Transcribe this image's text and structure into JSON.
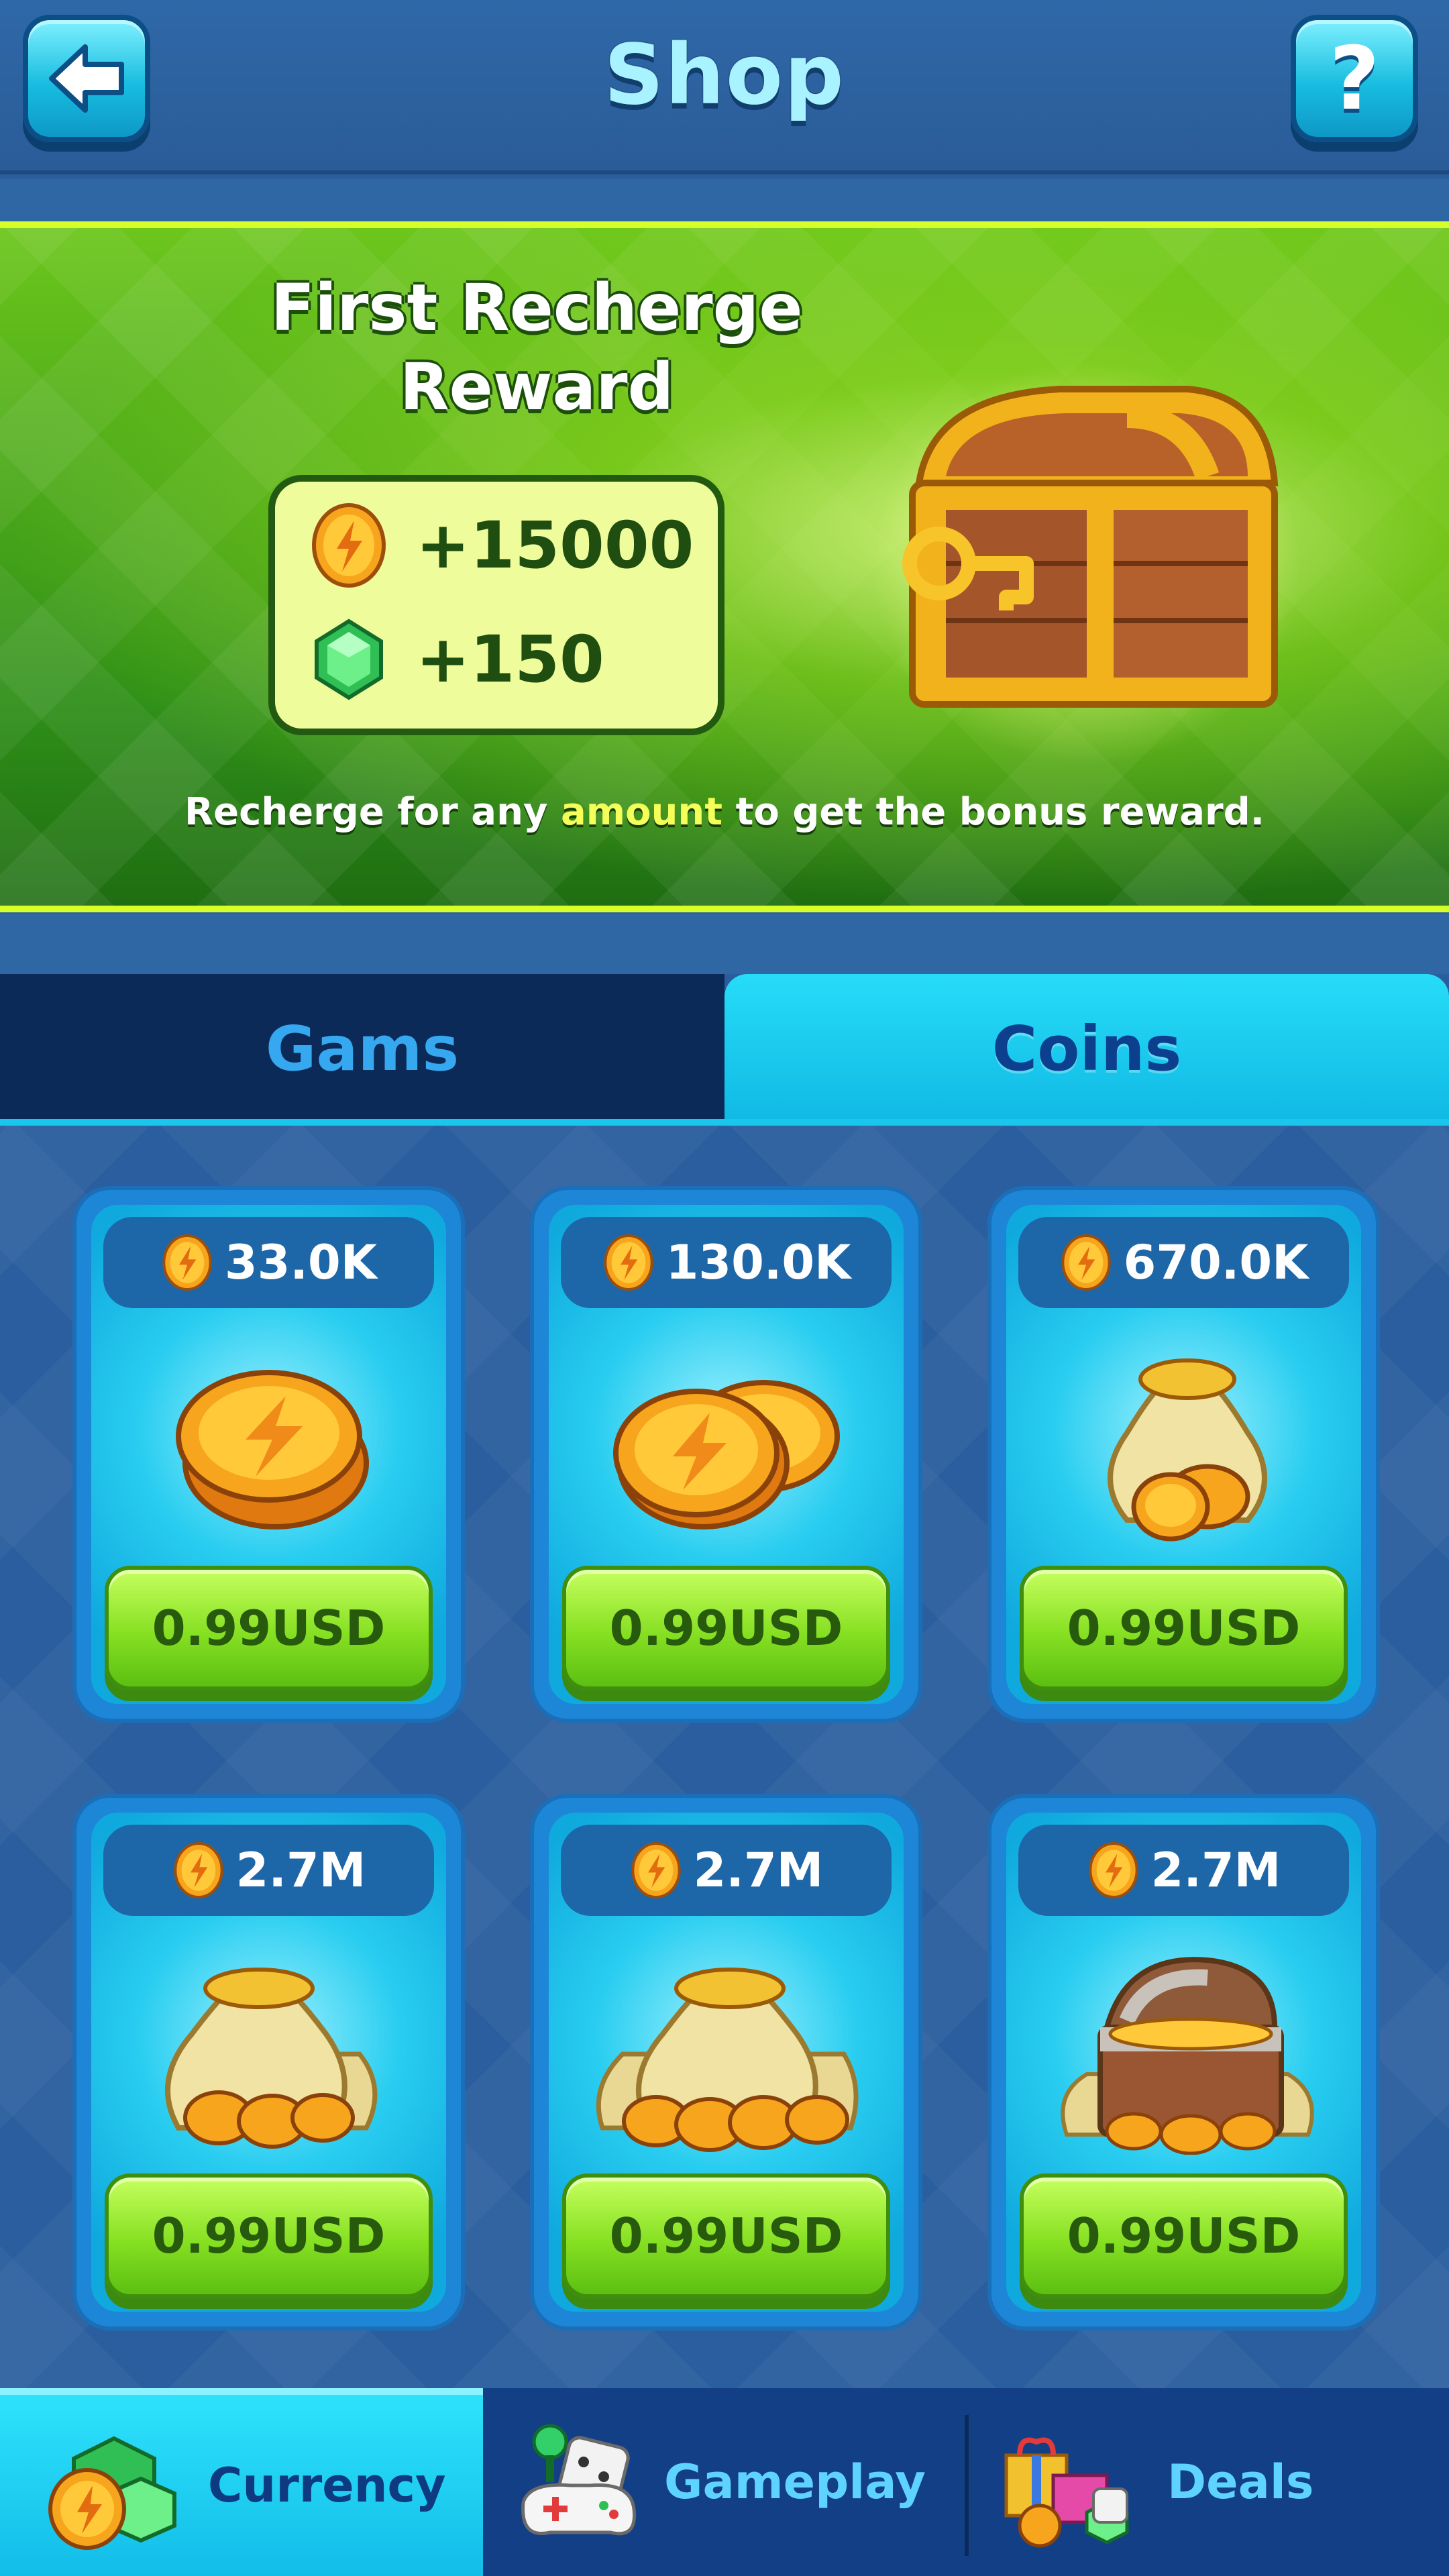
{
  "header": {
    "title": "Shop",
    "help_glyph": "?"
  },
  "banner": {
    "title_line1": "First Recherge",
    "title_line2": "Reward",
    "rewards": [
      {
        "icon": "coin-icon",
        "text": "+15000"
      },
      {
        "icon": "gem-icon",
        "text": "+150"
      }
    ],
    "note_before": "Recherge for any ",
    "note_highlight": "amount",
    "note_after": " to get the bonus reward."
  },
  "tabs": [
    {
      "label": "Gams",
      "active": false
    },
    {
      "label": "Coins",
      "active": true
    }
  ],
  "packs": [
    {
      "qty": "33.0K",
      "price": "0.99USD",
      "art": "coin-stack-small-icon"
    },
    {
      "qty": "130.0K",
      "price": "0.99USD",
      "art": "coin-pile-icon"
    },
    {
      "qty": "670.0K",
      "price": "0.99USD",
      "art": "coin-bag-icon"
    },
    {
      "qty": "2.7M",
      "price": "0.99USD",
      "art": "coin-bags-icon"
    },
    {
      "qty": "2.7M",
      "price": "0.99USD",
      "art": "coin-bags-large-icon"
    },
    {
      "qty": "2.7M",
      "price": "0.99USD",
      "art": "treasure-chest-coins-icon"
    }
  ],
  "nav": [
    {
      "label": "Currency",
      "icon": "currency-icon",
      "active": true
    },
    {
      "label": "Gameplay",
      "icon": "gameplay-icon",
      "active": false
    },
    {
      "label": "Deals",
      "icon": "deals-icon",
      "active": false
    }
  ],
  "colors": {
    "accent": "#19c6ec",
    "banner_green": "#6cc61c",
    "price_green": "#86e022",
    "coin_gold": "#f7b81d"
  }
}
